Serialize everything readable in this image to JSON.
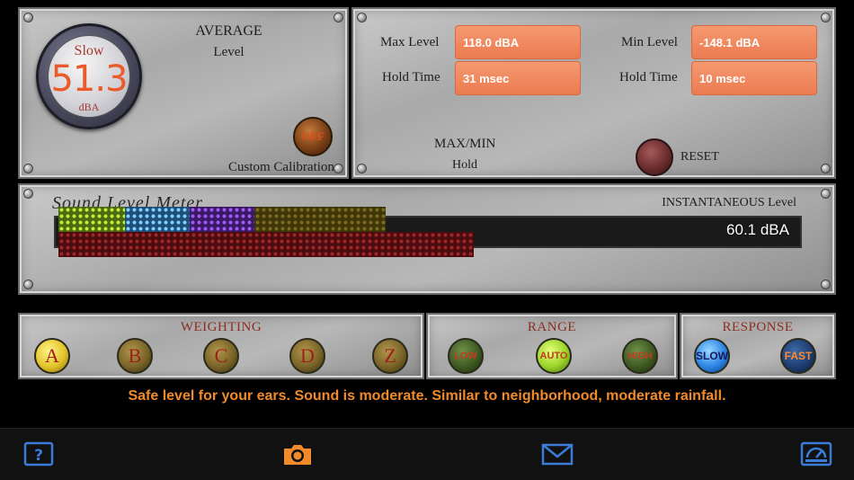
{
  "average_panel": {
    "mode": "Slow",
    "value": "51.3",
    "unit": "dBA",
    "title_line1": "AVERAGE",
    "title_line2": "Level",
    "calibration_toggle": "OFF",
    "calibration_label": "Custom Calibration"
  },
  "maxmin_panel": {
    "max_label": "Max Level",
    "max_value": "118.0 dBA",
    "max_hold_label": "Hold Time",
    "max_hold_value": "31 msec",
    "min_label": "Min Level",
    "min_value": "-148.1 dBA",
    "min_hold_label": "Hold Time",
    "min_hold_value": "10 msec",
    "title_line1": "MAX/MIN",
    "title_line2": "Hold",
    "reset_label": "RESET"
  },
  "meter_panel": {
    "title": "Sound Level Meter",
    "instantaneous_label": "INSTANTANEOUS  Level",
    "instantaneous_value": "60.1 dBA"
  },
  "weighting": {
    "title": "WEIGHTING",
    "options": [
      "A",
      "B",
      "C",
      "D",
      "Z"
    ],
    "selected": "A"
  },
  "range": {
    "title": "RANGE",
    "options": [
      "LOW",
      "AUTO",
      "HIGH"
    ],
    "selected": "AUTO"
  },
  "response": {
    "title": "RESPONSE",
    "options": [
      "SLOW",
      "FAST"
    ],
    "selected": "SLOW"
  },
  "status_message": "Safe level for your ears. Sound is moderate. Similar to neighborhood, moderate rainfall.",
  "toolbar": {
    "icons": [
      "help-icon",
      "camera-icon",
      "mail-icon",
      "meter-settings-icon"
    ]
  },
  "colors": {
    "accent_orange": "#f08a2a",
    "value_box": "#ec7a4f",
    "toolbar_blue": "#3a7cd8"
  }
}
